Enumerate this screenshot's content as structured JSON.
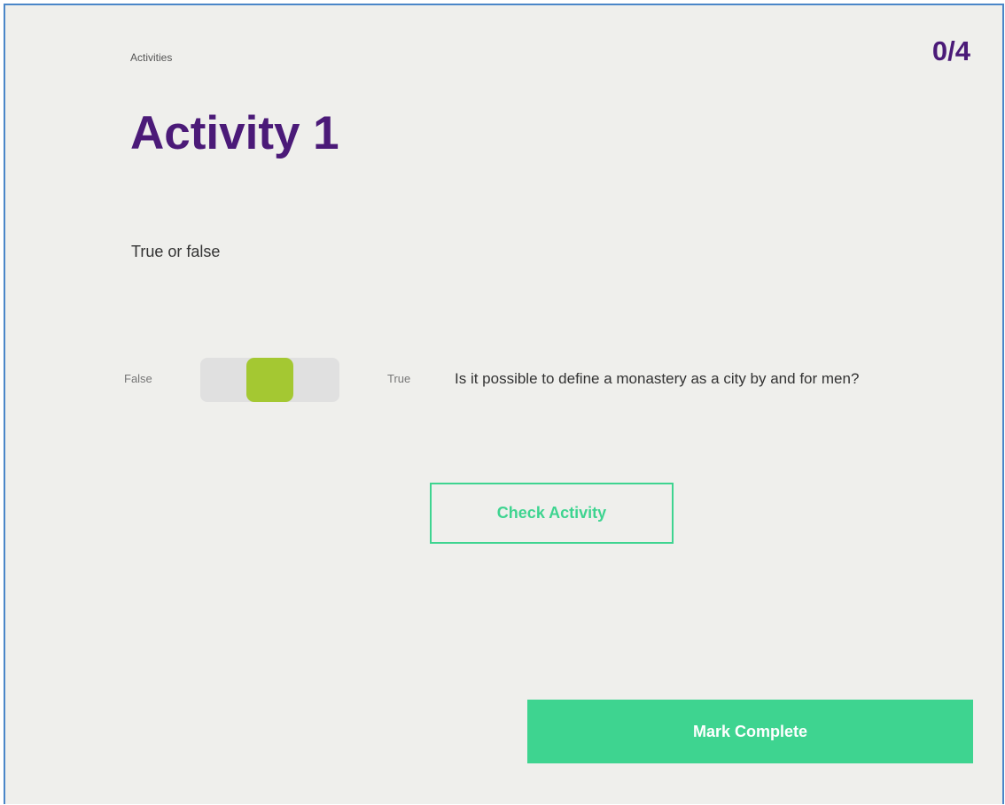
{
  "header": {
    "breadcrumb": "Activities",
    "progress": "0/4"
  },
  "activity": {
    "title": "Activity 1",
    "instruction": "True or false"
  },
  "question": {
    "false_label": "False",
    "true_label": "True",
    "text": "Is it possible to define a monastery as a city by and for men?",
    "toggle_state": "unanswered"
  },
  "buttons": {
    "check_label": "Check Activity",
    "complete_label": "Mark Complete"
  },
  "colors": {
    "title": "#4b1a78",
    "accent": "#3ed490",
    "toggle_knob": "#a4c832",
    "toggle_track": "#e0e0e0",
    "background": "#efefec",
    "frame_border": "#4a86c8"
  }
}
